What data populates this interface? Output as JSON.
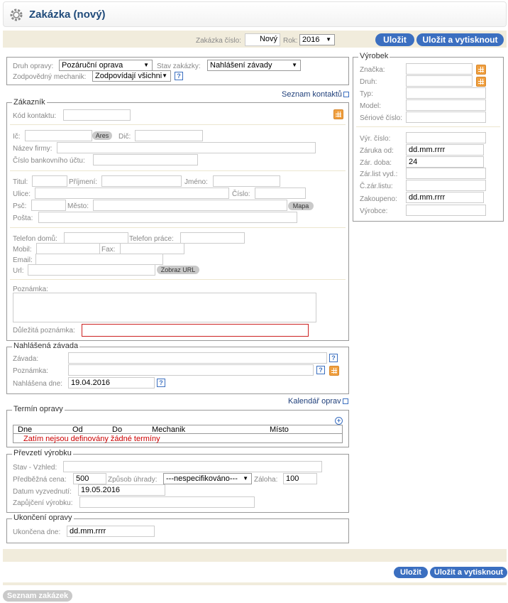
{
  "header": {
    "title": "Zakázka (nový)"
  },
  "toolbar": {
    "order_number_label": "Zakázka číslo:",
    "order_number_value": "Nový",
    "year_label": "Rok:",
    "year_value": "2016",
    "save_label": "Uložit",
    "save_print_label": "Uložit a vytisknout"
  },
  "repair": {
    "type_label": "Druh opravy:",
    "type_value": "Pozáruční oprava",
    "status_label": "Stav zakázky:",
    "status_value": "Nahlášení závady",
    "mechanic_label": "Zodpovědný mechanik:",
    "mechanic_value": "Zodpovídají všichni"
  },
  "contacts_link": "Seznam kontaktů",
  "customer": {
    "legend": "Zákazník",
    "contact_code_label": "Kód kontaktu:",
    "ic_label": "Ič:",
    "ares_label": "Ares",
    "dic_label": "Dič:",
    "company_label": "Název firmy:",
    "bank_label": "Číslo bankovního účtu:",
    "title_label": "Titul:",
    "surname_label": "Příjmení:",
    "name_label": "Jméno:",
    "street_label": "Ulice:",
    "number_label": "Číslo:",
    "zip_label": "Psč:",
    "city_label": "Město:",
    "map_label": "Mapa",
    "post_label": "Pošta:",
    "phone_home_label": "Telefon domů:",
    "phone_work_label": "Telefon práce:",
    "mobile_label": "Mobil:",
    "fax_label": "Fax:",
    "email_label": "Email:",
    "url_label": "Url:",
    "show_url_label": "Zobraz URL",
    "note_label": "Poznámka:",
    "important_note_label": "Důležitá poznámka:"
  },
  "product": {
    "legend": "Výrobek",
    "brand_label": "Značka:",
    "kind_label": "Druh:",
    "type_label": "Typ:",
    "model_label": "Model:",
    "serial_label": "Sériové číslo:",
    "prod_number_label": "Výr. číslo:",
    "warranty_from_label": "Záruka od:",
    "warranty_from_value": "dd.mm.rrrr",
    "warranty_period_label": "Zár. doba:",
    "warranty_period_value": "24",
    "warranty_issued_label": "Zár.list vyd.:",
    "warranty_number_label": "Č.zár.listu:",
    "purchased_label": "Zakoupeno:",
    "purchased_value": "dd.mm.rrrr",
    "manufacturer_label": "Výrobce:"
  },
  "defect": {
    "legend": "Nahlášená závada",
    "defect_label": "Závada:",
    "note_label": "Poznámka:",
    "reported_label": "Nahlášena dne:",
    "reported_value": "19.04.2016"
  },
  "calendar_link": "Kalendář oprav",
  "schedule": {
    "legend": "Termín opravy",
    "columns": [
      "Dne",
      "Od",
      "Do",
      "Mechanik",
      "Místo"
    ],
    "empty_text": "Zatím nejsou definovány žádné termíny"
  },
  "handover": {
    "legend": "Převzetí výrobku",
    "condition_label": "Stav - Vzhled:",
    "price_label": "Předběžná cena:",
    "price_value": "500",
    "payment_label": "Způsob úhrady:",
    "payment_value": "---nespecifikováno---",
    "deposit_label": "Záloha:",
    "deposit_value": "100",
    "pickup_label": "Datum vyzvednutí:",
    "pickup_value": "19.05.2016",
    "loan_label": "Zapůjčení výrobku:"
  },
  "completion": {
    "legend": "Ukončení opravy",
    "completed_label": "Ukončena dne:",
    "completed_value": "dd.mm.rrrr"
  },
  "bottom": {
    "save_label": "Uložit",
    "save_print_label": "Uložit a vytisknout",
    "orders_list_label": "Seznam zakázek"
  },
  "colors": {
    "accent": "#3b6fc0",
    "title": "#1f4a7a",
    "beige": "#f1ecdc",
    "error_text": "#cc0000"
  }
}
